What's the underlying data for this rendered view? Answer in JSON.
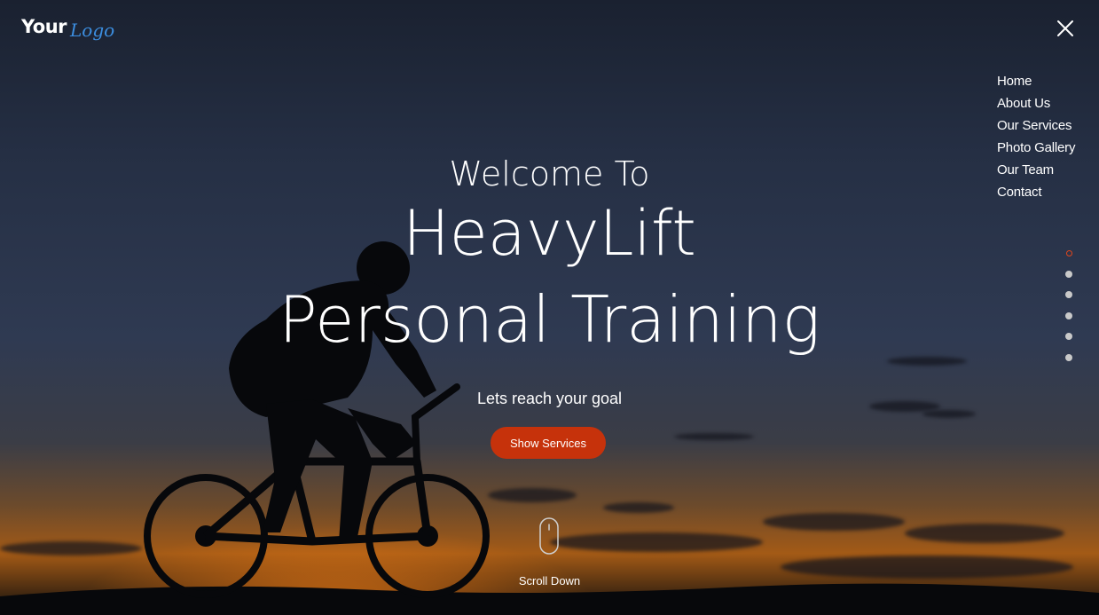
{
  "logo": {
    "word": "Your",
    "script": "Logo"
  },
  "icons": {
    "close": "close-icon",
    "mouse": "mouse-icon"
  },
  "nav": {
    "items": [
      {
        "label": "Home"
      },
      {
        "label": "About Us"
      },
      {
        "label": "Our Services"
      },
      {
        "label": "Photo Gallery"
      },
      {
        "label": "Our Team"
      },
      {
        "label": "Contact"
      }
    ]
  },
  "pager": {
    "count": 6,
    "active_index": 0
  },
  "hero": {
    "welcome": "Welcome To",
    "brand": "HeavyLift",
    "subtitle": "Personal Training",
    "tagline": "Lets reach your goal",
    "cta_label": "Show Services",
    "scroll_label": "Scroll Down"
  },
  "colors": {
    "accent": "#c6320b",
    "active_dot": "#e1461c",
    "logo_script": "#3c8ee0",
    "text": "#ffffff"
  }
}
